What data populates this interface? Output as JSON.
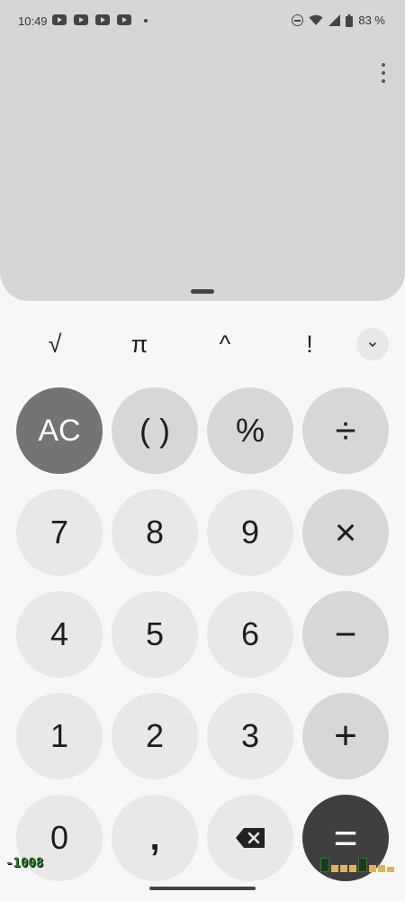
{
  "status_bar": {
    "time": "10:49",
    "battery": "83 %"
  },
  "scientific_row": {
    "sqrt": "√",
    "pi": "π",
    "power": "^",
    "factorial": "!"
  },
  "keypad": {
    "ac": "AC",
    "parens": "( )",
    "percent": "%",
    "divide": "÷",
    "seven": "7",
    "eight": "8",
    "nine": "9",
    "multiply": "×",
    "four": "4",
    "five": "5",
    "six": "6",
    "minus": "−",
    "one": "1",
    "two": "2",
    "three": "3",
    "plus": "+",
    "zero": "0",
    "decimal": ",",
    "equals": "="
  },
  "overlay": {
    "counter": "-1008"
  },
  "colors": {
    "display_bg": "#d6d6d6",
    "number_key": "#e8e8e8",
    "function_key": "#d7d7d7",
    "ac_key": "#747474",
    "equals_key": "#3f3f3f"
  }
}
